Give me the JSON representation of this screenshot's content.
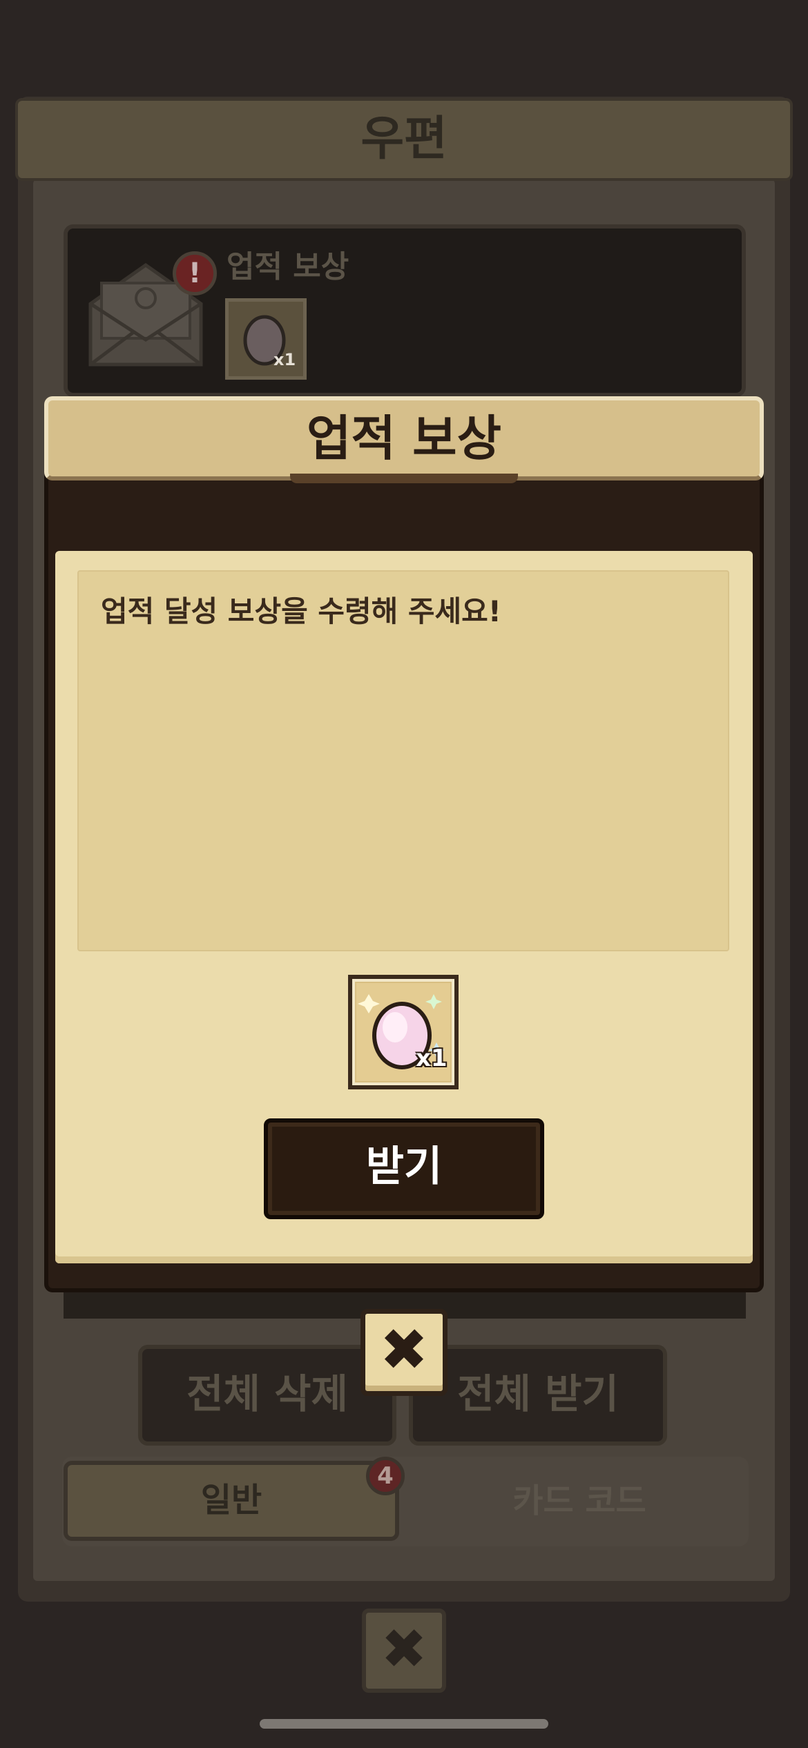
{
  "mailbox": {
    "title": "우편",
    "item": {
      "title": "업적 보상",
      "alert": "!",
      "reward_count": "x1",
      "envelope_icon": "envelope-icon",
      "egg_icon": "egg-icon"
    },
    "delete_all_label": "전체 삭제",
    "receive_all_label": "전체 받기",
    "tabs": [
      {
        "label": "일반",
        "badge": "4"
      },
      {
        "label": "카드 코드"
      }
    ],
    "close_glyph": "✖"
  },
  "modal": {
    "title": "업적 보상",
    "message": "업적 달성 보상을 수령해 주세요!",
    "reward": {
      "icon": "pink-egg-icon",
      "count": "x1"
    },
    "receive_label": "받기",
    "close_glyph": "✖"
  },
  "colors": {
    "parchment": "#ebdcac",
    "header": "#d6bf8b",
    "dark_brown": "#2a1b10",
    "alert_red": "#6a2323"
  }
}
